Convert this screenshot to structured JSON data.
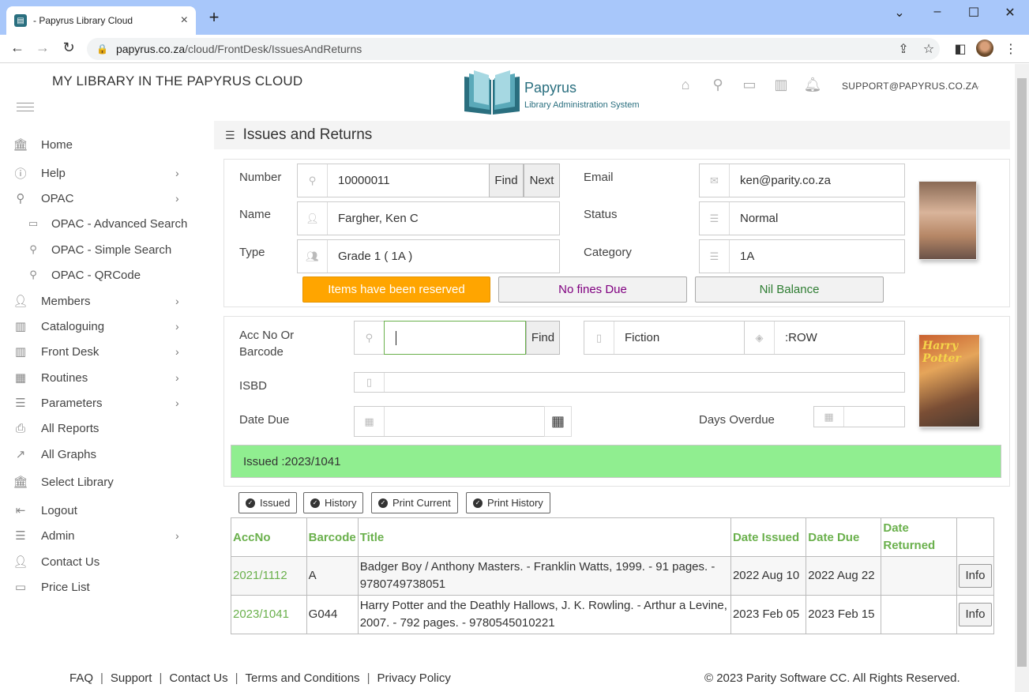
{
  "browser": {
    "tab_title": "- Papyrus Library Cloud",
    "url_host": "papyrus.co.za",
    "url_path": "/cloud/FrontDesk/IssuesAndReturns"
  },
  "header": {
    "site_title": "MY LIBRARY IN THE PAPYRUS CLOUD",
    "logo_name": "Papyrus",
    "logo_subtitle": "Library Administration System",
    "user_email": "SUPPORT@PAPYRUS.CO.ZA",
    "icons": [
      "home-icon",
      "search-icon",
      "return-icon",
      "catalogue-icon",
      "bell-icon"
    ]
  },
  "sidebar": {
    "items": [
      {
        "label": "Home",
        "icon": "bank-icon"
      },
      {
        "label": "Help",
        "icon": "info-icon"
      },
      {
        "label": "OPAC",
        "icon": "search-icon"
      },
      {
        "label": "OPAC - Advanced Search",
        "icon": "monitor-icon"
      },
      {
        "label": "OPAC - Simple Search",
        "icon": "search-icon"
      },
      {
        "label": "OPAC - QRCode",
        "icon": "search-icon"
      },
      {
        "label": "Members",
        "icon": "users-icon"
      },
      {
        "label": "Cataloguing",
        "icon": "book-icon"
      },
      {
        "label": "Front Desk",
        "icon": "book-icon"
      },
      {
        "label": "Routines",
        "icon": "calendar-icon"
      },
      {
        "label": "Parameters",
        "icon": "list-icon"
      },
      {
        "label": "All Reports",
        "icon": "printer-icon"
      },
      {
        "label": "All Graphs",
        "icon": "chart-icon"
      },
      {
        "label": "Select Library",
        "icon": "bank-icon"
      },
      {
        "label": "Logout",
        "icon": "logout-icon"
      },
      {
        "label": "Admin",
        "icon": "database-icon"
      },
      {
        "label": "Contact Us",
        "icon": "user-icon"
      },
      {
        "label": "Price List",
        "icon": "folder-icon"
      }
    ]
  },
  "main": {
    "title": "Issues and Returns",
    "member": {
      "number_label": "Number",
      "number_value": "10000011",
      "find_label": "Find",
      "next_label": "Next",
      "name_label": "Name",
      "name_value": "Fargher, Ken C",
      "type_label": "Type",
      "type_value": "Grade 1 ( 1A )",
      "email_label": "Email",
      "email_value": "ken@parity.co.za",
      "status_label": "Status",
      "status_value": "Normal",
      "category_label": "Category",
      "category_value": "1A",
      "reserved_label": "Items have been reserved",
      "fines_label": "No fines Due",
      "balance_label": "Nil Balance",
      "colors": {
        "reserved": "#ffa500",
        "fines": "#800080",
        "balance": "#2e7d32"
      }
    },
    "item": {
      "acc_label": "Acc No Or Barcode",
      "acc_value": "",
      "find_label": "Find",
      "section_value": "Fiction",
      "location_value": ":ROW",
      "isbd_label": "ISBD",
      "isbd_value": "",
      "date_due_label": "Date Due",
      "date_due_value": "",
      "days_overdue_label": "Days Overdue",
      "days_overdue_value": "",
      "cover_title": "Harry Potter",
      "issued_message": "Issued :2023/1041"
    },
    "actions": [
      "Issued",
      "History",
      "Print Current",
      "Print History"
    ],
    "table": {
      "headers": [
        "AccNo",
        "Barcode",
        "Title",
        "Date Issued",
        "Date Due",
        "Date Returned",
        ""
      ],
      "rows": [
        {
          "accno": "2021/1112",
          "barcode": "A",
          "title": "Badger Boy / Anthony Masters. - Franklin Watts, 1999. - 91 pages. - 9780749738051",
          "issued": "2022 Aug 10",
          "due": "2022 Aug 22",
          "returned": "",
          "action": "Info"
        },
        {
          "accno": "2023/1041",
          "barcode": "G044",
          "title": "Harry Potter and the Deathly Hallows, J. K. Rowling. - Arthur a Levine, 2007. - 792 pages. - 9780545010221",
          "issued": "2023 Feb 05",
          "due": "2023 Feb 15",
          "returned": "",
          "action": "Info"
        }
      ]
    }
  },
  "footer": {
    "links": [
      "FAQ",
      "Support",
      "Contact Us",
      "Terms and Conditions",
      "Privacy Policy"
    ],
    "copyright": "© 2023 Parity Software CC. All Rights Reserved."
  }
}
